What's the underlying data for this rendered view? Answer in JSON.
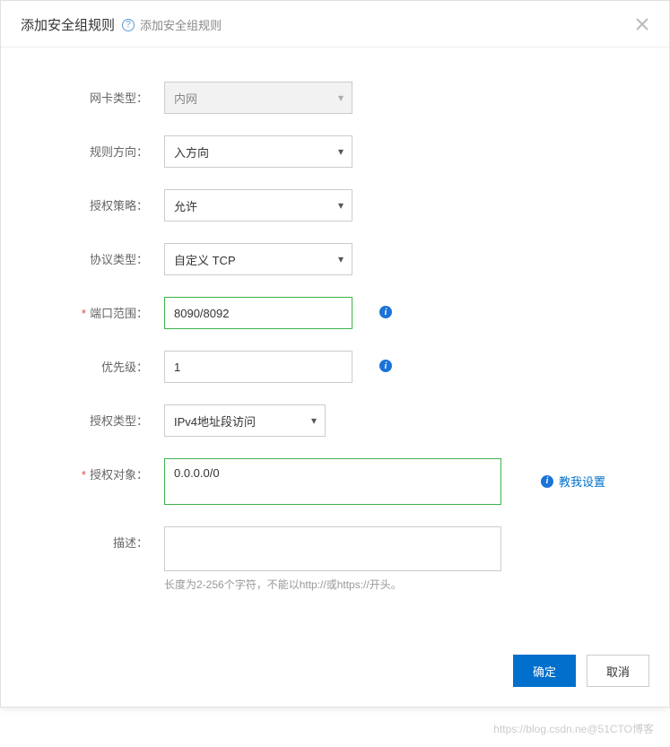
{
  "modal": {
    "title": "添加安全组规则",
    "help_text": "添加安全组规则"
  },
  "form": {
    "nic_type": {
      "label": "网卡类型：",
      "value": "内网"
    },
    "direction": {
      "label": "规则方向：",
      "value": "入方向"
    },
    "policy": {
      "label": "授权策略：",
      "value": "允许"
    },
    "protocol": {
      "label": "协议类型：",
      "value": "自定义 TCP"
    },
    "port_range": {
      "label": "端口范围：",
      "value": "8090/8092"
    },
    "priority": {
      "label": "优先级：",
      "value": "1"
    },
    "auth_type": {
      "label": "授权类型：",
      "value": "IPv4地址段访问"
    },
    "auth_object": {
      "label": "授权对象：",
      "value": "0.0.0.0/0",
      "teach": "教我设置"
    },
    "description": {
      "label": "描述：",
      "value": "",
      "hint": "长度为2-256个字符，不能以http://或https://开头。"
    }
  },
  "footer": {
    "ok": "确定",
    "cancel": "取消"
  },
  "watermark": "https://blog.csdn.ne@51CTO博客"
}
